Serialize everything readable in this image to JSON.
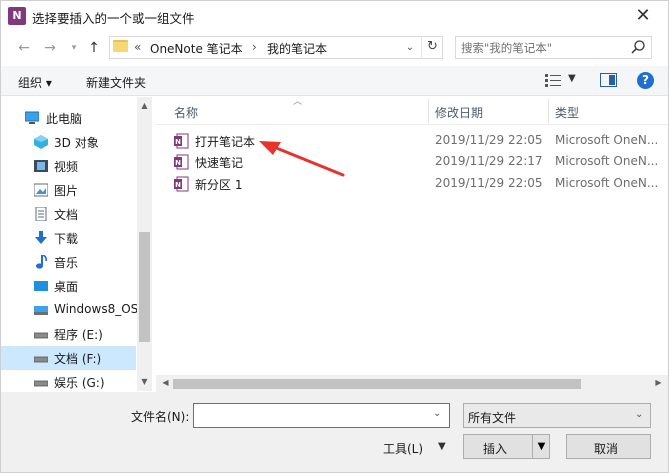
{
  "window": {
    "title": "选择要插入的一个或一组文件",
    "app_icon_letter": "N",
    "close_glyph": "✕"
  },
  "address": {
    "prefix": "«",
    "crumbs": [
      "OneNote 笔记本",
      "我的笔记本"
    ],
    "separator": "›",
    "search_placeholder": "搜索\"我的笔记本\""
  },
  "toolbar": {
    "organize": "组织 ▾",
    "new_folder": "新建文件夹"
  },
  "nav": {
    "root": "此电脑",
    "items": [
      {
        "label": "3D 对象",
        "icon": "3d-objects-icon"
      },
      {
        "label": "视频",
        "icon": "video-icon"
      },
      {
        "label": "图片",
        "icon": "pictures-icon"
      },
      {
        "label": "文档",
        "icon": "documents-icon"
      },
      {
        "label": "下载",
        "icon": "download-icon"
      },
      {
        "label": "音乐",
        "icon": "music-icon"
      },
      {
        "label": "桌面",
        "icon": "desktop-icon"
      },
      {
        "label": "Windows8_OS",
        "icon": "drive-icon"
      },
      {
        "label": "程序 (E:)",
        "icon": "drive-icon"
      },
      {
        "label": "文档 (F:)",
        "icon": "drive-icon"
      },
      {
        "label": "娱乐 (G:)",
        "icon": "drive-icon"
      }
    ],
    "selected_index": 9
  },
  "list": {
    "columns": {
      "name": "名称",
      "modified": "修改日期",
      "type": "类型"
    },
    "rows": [
      {
        "name": "打开笔记本",
        "modified": "2019/11/29 22:05",
        "type": "Microsoft OneN..."
      },
      {
        "name": "快速笔记",
        "modified": "2019/11/29 22:17",
        "type": "Microsoft OneN..."
      },
      {
        "name": "新分区 1",
        "modified": "2019/11/29 22:05",
        "type": "Microsoft OneN..."
      }
    ]
  },
  "bottom": {
    "filename_label": "文件名(N):",
    "filename_value": "",
    "filetype": "所有文件",
    "tools": "工具(L)",
    "insert": "插入",
    "cancel": "取消"
  },
  "colors": {
    "onenote_purple": "#80397b",
    "selection": "#cce8ff",
    "accent_blue": "#2f7bd6",
    "annotation_red": "#e8322c"
  }
}
